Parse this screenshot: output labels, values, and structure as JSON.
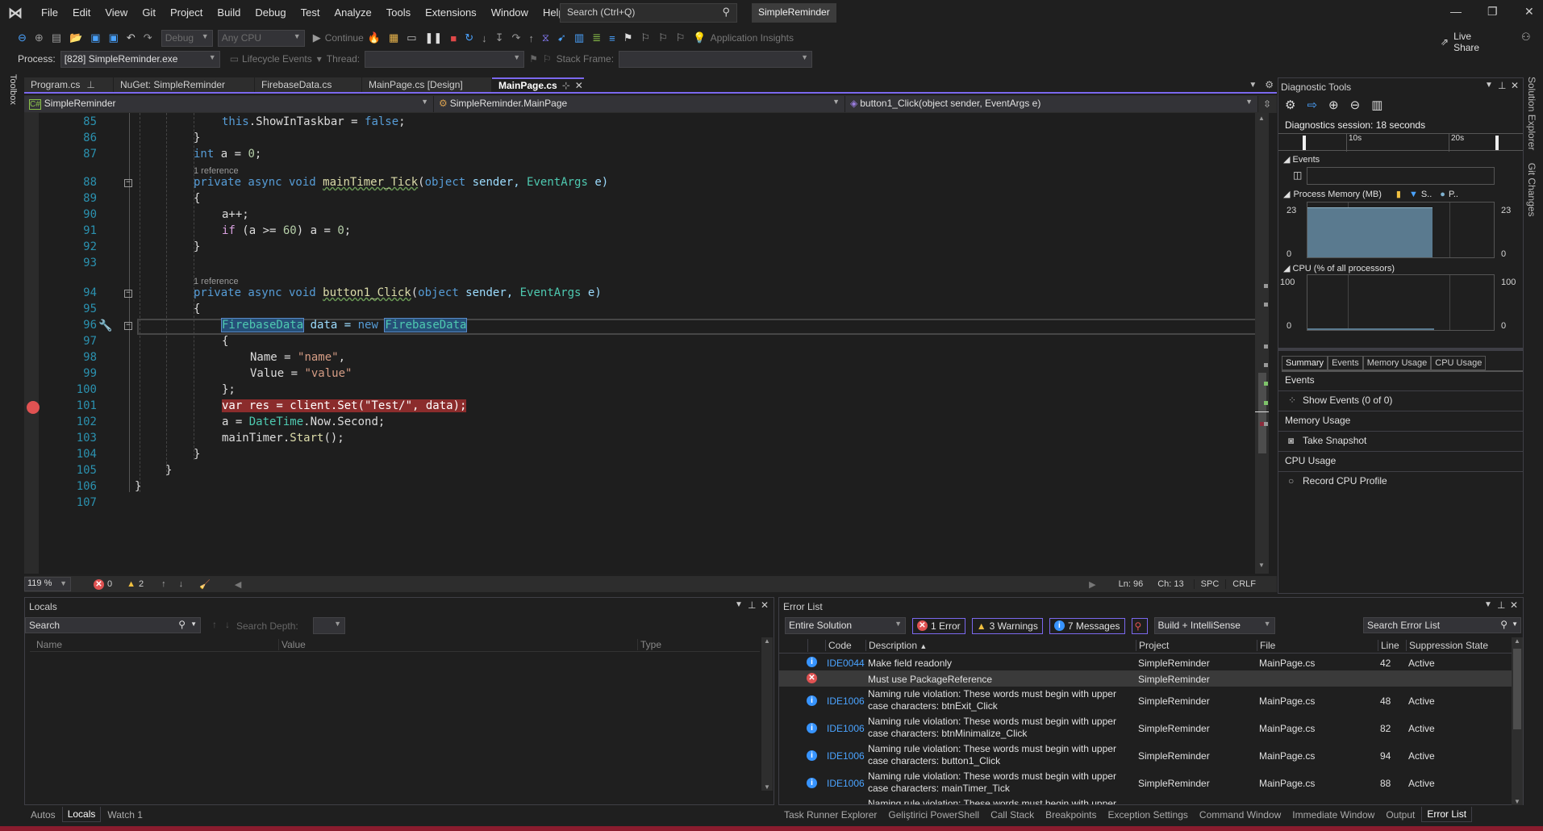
{
  "menubar": {
    "items": [
      "File",
      "Edit",
      "View",
      "Git",
      "Project",
      "Build",
      "Debug",
      "Test",
      "Analyze",
      "Tools",
      "Extensions",
      "Window",
      "Help"
    ],
    "search_placeholder": "Search (Ctrl+Q)",
    "solution_name": "SimpleReminder"
  },
  "toolbar": {
    "config": "Debug",
    "platform": "Any CPU",
    "continue_label": "Continue",
    "app_insights": "Application Insights",
    "live_share": "Live Share"
  },
  "debug_location": {
    "process_label": "Process:",
    "process_value": "[828] SimpleReminder.exe",
    "lifecycle_label": "Lifecycle Events",
    "thread_label": "Thread:",
    "stack_frame_label": "Stack Frame:"
  },
  "side_labels": {
    "toolbox": "Toolbox",
    "right": [
      "Solution Explorer",
      "Git Changes"
    ]
  },
  "doc_tabs": [
    {
      "label": "Program.cs",
      "pinned": true,
      "active": false
    },
    {
      "label": "NuGet: SimpleReminder",
      "active": false
    },
    {
      "label": "FirebaseData.cs",
      "active": false
    },
    {
      "label": "MainPage.cs [Design]",
      "active": false
    },
    {
      "label": "MainPage.cs",
      "active": true
    }
  ],
  "navbar": {
    "project": "SimpleReminder",
    "type": "SimpleReminder.MainPage",
    "member": "button1_Click(object sender, EventArgs e)"
  },
  "editor": {
    "line_numbers": [
      "85",
      "86",
      "87",
      "88",
      "89",
      "90",
      "91",
      "92",
      "93",
      "94",
      "95",
      "96",
      "97",
      "98",
      "99",
      "100",
      "101",
      "102",
      "103",
      "104",
      "105",
      "106",
      "107"
    ],
    "reference_hint": "1 reference",
    "lines": {
      "l85": {
        "kw": "this",
        "rest": ".ShowInTaskbar = ",
        "val": "false",
        "end": ";"
      },
      "l86": "}",
      "l87": {
        "kw": "int",
        "rest": " a = ",
        "num": "0",
        "end": ";"
      },
      "l88": {
        "kw": "private async void ",
        "fn": "mainTimer_Tick",
        "open": "(",
        "kw2": "object",
        "p": " sender, ",
        "ty": "EventArgs",
        "end": " e)"
      },
      "l89": "{",
      "l90": "a++;",
      "l91": {
        "ct": "if",
        "a": " (a >= ",
        "num": "60",
        "b": ") a = ",
        "num2": "0",
        "end": ";"
      },
      "l92": "}",
      "l94": {
        "kw": "private async void ",
        "fn": "button1_Click",
        "open": "(",
        "kw2": "object",
        "p": " sender, ",
        "ty": "EventArgs",
        "end": " e)"
      },
      "l95": "{",
      "l96": {
        "ty": "FirebaseData",
        "mid": " data = ",
        "kw": "new",
        "ty2": "FirebaseData"
      },
      "l97": "{",
      "l98": {
        "a": "Name = ",
        "s": "\"name\"",
        "end": ","
      },
      "l99": {
        "a": "Value = ",
        "s": "\"value\""
      },
      "l100": "};",
      "l101": "var res = client.Set(\"Test/\", data);",
      "l102": {
        "a": "a = ",
        "ty": "DateTime",
        "end": ".Now.Second;"
      },
      "l103": {
        "a": "mainTimer.",
        "fn": "Start",
        "end": "();"
      },
      "l104": "}",
      "l105": "}",
      "l106": "}"
    }
  },
  "editor_status": {
    "zoom": "119 %",
    "errors": "0",
    "warnings": "2",
    "line": "Ln: 96",
    "char": "Ch: 13",
    "spacing": "SPC",
    "line_ending": "CRLF"
  },
  "diagnostic_tools": {
    "title": "Diagnostic Tools",
    "session": "Diagnostics session: 18 seconds",
    "timeline_ticks": [
      "10s",
      "20s"
    ],
    "events_label": "Events",
    "memory_label": "Process Memory (MB)",
    "memory_legend": [
      "S..",
      "P.."
    ],
    "memory_max": "23",
    "memory_min": "0",
    "memory_fill_fraction": 0.67,
    "cpu_label": "CPU (% of all processors)",
    "cpu_max": "100",
    "cpu_min": "0",
    "tabs": [
      "Summary",
      "Events",
      "Memory Usage",
      "CPU Usage"
    ],
    "sections": [
      {
        "title": "Events",
        "action": "Show Events (0 of 0)"
      },
      {
        "title": "Memory Usage",
        "action": "Take Snapshot"
      },
      {
        "title": "CPU Usage",
        "action": "Record CPU Profile"
      }
    ]
  },
  "locals": {
    "title": "Locals",
    "search_placeholder": "Search",
    "search_depth_label": "Search Depth:",
    "columns": [
      "Name",
      "Value",
      "Type"
    ],
    "tabs": [
      "Autos",
      "Locals",
      "Watch 1"
    ],
    "active_tab": "Locals"
  },
  "error_list": {
    "title": "Error List",
    "scope": "Entire Solution",
    "errors_badge": "1 Error",
    "warnings_badge": "3 Warnings",
    "messages_badge": "7 Messages",
    "source_filter": "Build + IntelliSense",
    "search_placeholder": "Search Error List",
    "columns": [
      "Code",
      "Description",
      "Project",
      "File",
      "Line",
      "Suppression State"
    ],
    "rows": [
      {
        "type": "info",
        "code": "IDE0044",
        "desc": "Make field readonly",
        "desc2": "",
        "project": "SimpleReminder",
        "file": "MainPage.cs",
        "line": "42",
        "state": "Active"
      },
      {
        "type": "error",
        "code": "",
        "desc": "Must use PackageReference",
        "desc2": "",
        "project": "SimpleReminder",
        "file": "",
        "line": "",
        "state": ""
      },
      {
        "type": "info",
        "code": "IDE1006",
        "desc": "Naming rule violation: These words must begin with upper",
        "desc2": "case characters: btnExit_Click",
        "project": "SimpleReminder",
        "file": "MainPage.cs",
        "line": "48",
        "state": "Active"
      },
      {
        "type": "info",
        "code": "IDE1006",
        "desc": "Naming rule violation: These words must begin with upper",
        "desc2": "case characters: btnMinimalize_Click",
        "project": "SimpleReminder",
        "file": "MainPage.cs",
        "line": "82",
        "state": "Active"
      },
      {
        "type": "info",
        "code": "IDE1006",
        "desc": "Naming rule violation: These words must begin with upper",
        "desc2": "case characters: button1_Click",
        "project": "SimpleReminder",
        "file": "MainPage.cs",
        "line": "94",
        "state": "Active"
      },
      {
        "type": "info",
        "code": "IDE1006",
        "desc": "Naming rule violation: These words must begin with upper",
        "desc2": "case characters: mainTimer_Tick",
        "project": "SimpleReminder",
        "file": "MainPage.cs",
        "line": "88",
        "state": "Active"
      },
      {
        "type": "info",
        "code": "",
        "desc": "Naming rule violation: These words must begin with upper",
        "desc2": "",
        "project": "",
        "file": "",
        "line": "",
        "state": ""
      }
    ],
    "bottom_tabs": [
      "Task Runner Explorer",
      "Geliştirici PowerShell",
      "Call Stack",
      "Breakpoints",
      "Exception Settings",
      "Command Window",
      "Immediate Window",
      "Output",
      "Error List"
    ],
    "active_tab": "Error List"
  },
  "colors": {
    "accent": "#7b68ee",
    "statusbar": "#8a1c2e",
    "breakpoint": "#e05252",
    "line_number": "#2b91af"
  }
}
